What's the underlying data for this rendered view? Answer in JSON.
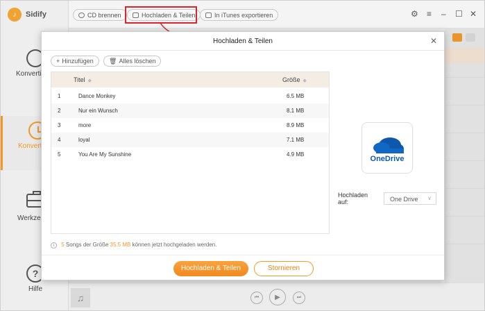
{
  "app": {
    "name": "Sidify"
  },
  "sidebar": {
    "items": [
      {
        "label": "Konverti",
        "icon": "convert-icon",
        "active": false
      },
      {
        "label": "Konverti",
        "icon": "history-clock-icon",
        "active": true
      },
      {
        "label": "Werkze",
        "icon": "toolbox-icon",
        "active": false
      },
      {
        "label": "Hilfe",
        "icon": "help-icon",
        "active": false
      }
    ]
  },
  "toolbar": {
    "cd_label": "CD brennen",
    "upload_label": "Hochladen & Teilen",
    "itunes_label": "In iTunes exportieren"
  },
  "dialog": {
    "title": "Hochladen & Teilen",
    "add_label": "Hinzufügen",
    "clear_label": "Alles löschen",
    "columns": {
      "title": "Titel",
      "size": "Größe"
    },
    "rows": [
      {
        "num": "1",
        "title": "Dance Monkey",
        "size": "6.5 MB"
      },
      {
        "num": "2",
        "title": "Nur ein Wunsch",
        "size": "8.1 MB"
      },
      {
        "num": "3",
        "title": "more",
        "size": "8.9 MB"
      },
      {
        "num": "4",
        "title": "loyal",
        "size": "7.1 MB"
      },
      {
        "num": "5",
        "title": "You Are My Sunshine",
        "size": "4.9 MB"
      }
    ],
    "service_name": "OneDrive",
    "upload_to_label": "Hochladen auf:",
    "upload_to_value": "One Drive",
    "info": {
      "count": "5",
      "text_a": "Songs der Größe",
      "size": "35.5 MB",
      "text_b": "können jetzt hochgeladen werden."
    },
    "primary_label": "Hochladen & Teilen",
    "cancel_label": "Stornieren"
  },
  "colors": {
    "accent": "#f39826",
    "highlight": "#d7262f",
    "onedrive": "#0f57ad"
  }
}
